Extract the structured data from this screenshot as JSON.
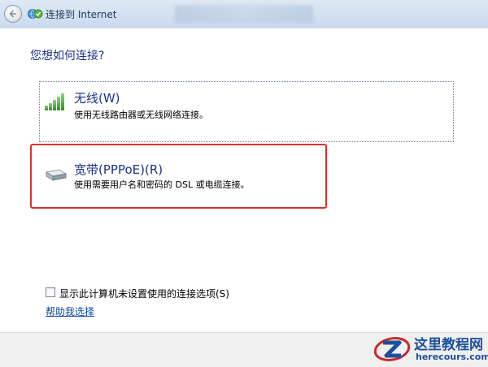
{
  "window": {
    "title": "连接到 Internet"
  },
  "main": {
    "question": "您想如何连接?",
    "options": [
      {
        "title": "无线(W)",
        "description": "使用无线路由器或无线网络连接。",
        "icon": "wireless-signal-icon"
      },
      {
        "title": "宽带(PPPoE)(R)",
        "description": "使用需要用户名和密码的 DSL 或电缆连接。",
        "icon": "broadband-modem-icon",
        "highlight_color": "#d5332c"
      }
    ],
    "show_unsetup_checkbox": {
      "label": "显示此计算机未设置使用的连接选项(S)",
      "checked": false
    },
    "help_link": "帮助我选择"
  },
  "watermark": {
    "name": "这里教程网",
    "url": "herecours.com"
  },
  "colors": {
    "heading": "#1e3287",
    "link": "#0d4a9e",
    "highlight": "#d5332c",
    "watermark": "#1d4f9d"
  }
}
